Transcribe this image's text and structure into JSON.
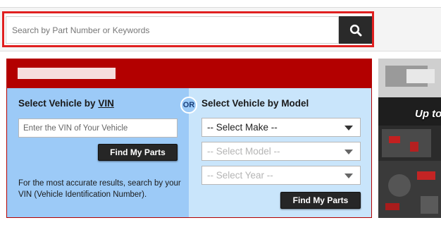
{
  "search": {
    "placeholder": "Search by Part Number or Keywords",
    "button_icon": "search-icon"
  },
  "vin_section": {
    "heading_prefix": "Select Vehicle by ",
    "heading_link": "VIN",
    "input_placeholder": "Enter the VIN of Your Vehicle",
    "button_label": "Find My Parts",
    "note": "For the most accurate results, search by your VIN (Vehicle Identification Number)."
  },
  "or_label": "OR",
  "model_section": {
    "heading": "Select Vehicle by Model",
    "make_select": "-- Select Make --",
    "model_select": "-- Select Model --",
    "year_select": "-- Select Year --",
    "button_label": "Find My Parts"
  },
  "promo": {
    "text": "Up to"
  },
  "colors": {
    "header_red": "#b30000",
    "highlight_red": "#e02020",
    "vin_panel_blue": "#9ccaf7",
    "model_panel_blue": "#c9e5fb",
    "button_dark": "#262626"
  }
}
